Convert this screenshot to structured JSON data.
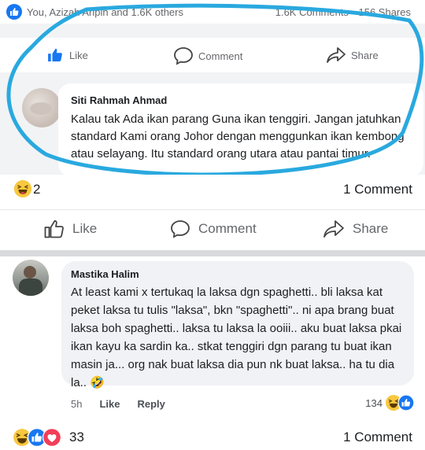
{
  "top": {
    "summary": "You, Azizah Aripin and 1.6K others",
    "comments_count": "1.6K Comments",
    "shares": "156 Shares",
    "like_label": "Like",
    "comment_label": "Comment",
    "share_label": "Share",
    "comment": {
      "author": "Siti Rahmah Ahmad",
      "text": "Kalau tak Ada ikan parang Guna ikan tenggiri. Jangan jatuhkan standard Kami orang Johor dengan menggunkan ikan kembong atau selayang. Itu standard orang utara atau pantai timur."
    }
  },
  "middle": {
    "reaction_count": "2",
    "comment_count": "1 Comment",
    "like_label": "Like",
    "comment_label": "Comment",
    "share_label": "Share"
  },
  "comment2": {
    "author": "Mastika Halim",
    "text": "At least kami x tertukaq la laksa dgn spaghetti.. bli laksa kat peket laksa tu tulis \"laksa\", bkn \"spaghetti\".. ni apa brang buat laksa boh spaghetti.. laksa tu laksa la ooiii.. aku buat laksa pkai ikan kayu ka sardin ka.. stkat tenggiri dgn parang tu buat ikan masin ja... org nak buat laksa dia pun nk buat laksa.. ha tu dia la.. 🤣",
    "time": "5h",
    "like_label": "Like",
    "reply_label": "Reply",
    "reaction_count": "134"
  },
  "bottom": {
    "reaction_count": "33",
    "comment_count": "1 Comment"
  },
  "colors": {
    "facebook_blue": "#1877f2",
    "annotation_circle": "#29a9df",
    "haha_yellow": "#f7c840",
    "love_red": "#f33e58"
  },
  "icons": [
    "like-icon",
    "comment-icon",
    "share-icon",
    "haha-icon",
    "love-icon"
  ]
}
